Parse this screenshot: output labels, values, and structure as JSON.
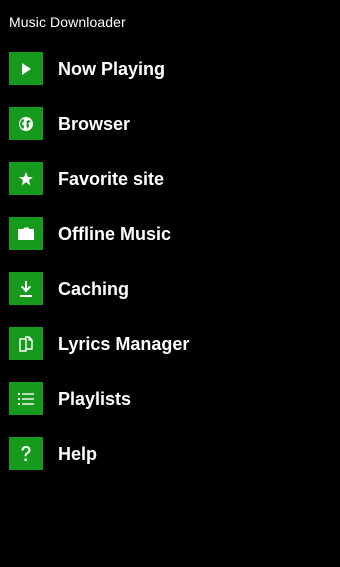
{
  "app": {
    "title": "Music Downloader"
  },
  "colors": {
    "background": "#000000",
    "tile": "#159a1e",
    "text": "#ffffff"
  },
  "menu": {
    "items": [
      {
        "label": "Now Playing",
        "icon": "play-icon"
      },
      {
        "label": "Browser",
        "icon": "globe-icon"
      },
      {
        "label": "Favorite site",
        "icon": "star-icon"
      },
      {
        "label": "Offline Music",
        "icon": "folder-icon"
      },
      {
        "label": "Caching",
        "icon": "download-icon"
      },
      {
        "label": "Lyrics Manager",
        "icon": "documents-icon"
      },
      {
        "label": "Playlists",
        "icon": "list-icon"
      },
      {
        "label": "Help",
        "icon": "question-icon"
      }
    ]
  }
}
